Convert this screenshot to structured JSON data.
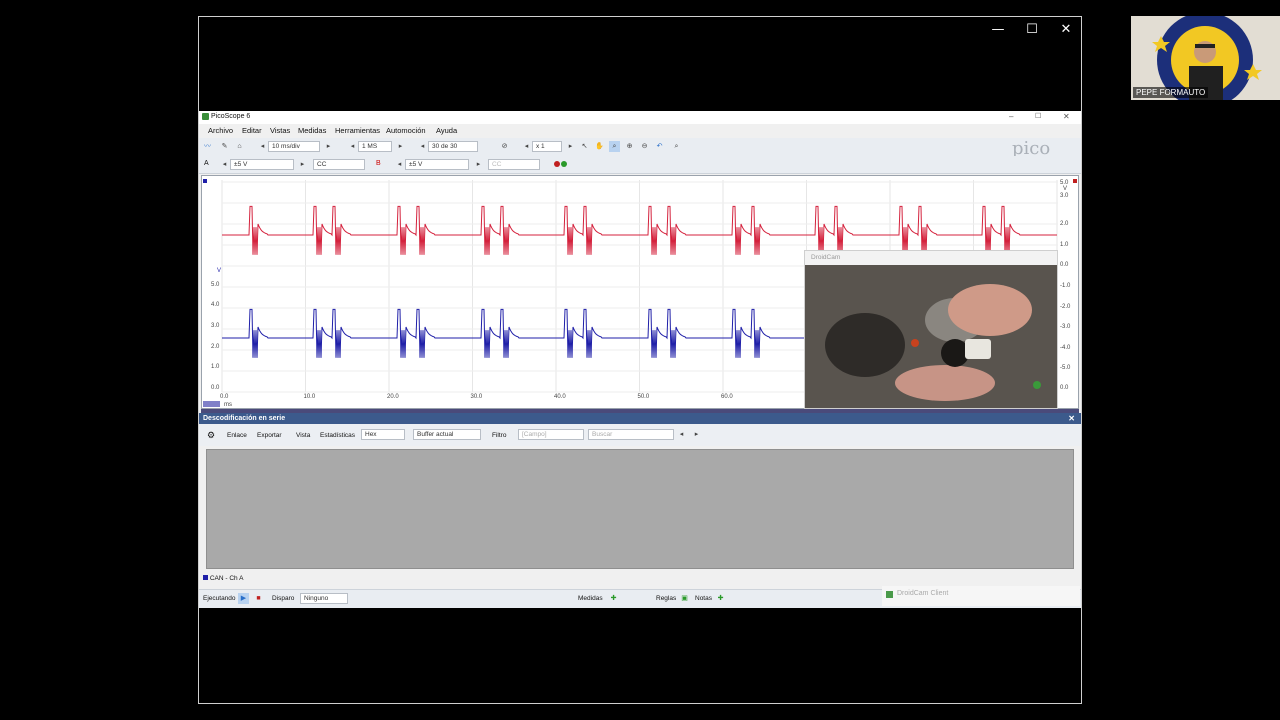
{
  "share": {
    "minimize": "—",
    "maximize": "☐",
    "close": "✕"
  },
  "webcam": {
    "name": "PEPE FORMAUTO"
  },
  "pico": {
    "title": "PicoScope 6",
    "menu": [
      "Archivo",
      "Editar",
      "Vistas",
      "Medidas",
      "Herramientas",
      "Automoción",
      "Ayuda"
    ],
    "toolbar1": {
      "timebase": "10 ms/div",
      "samples": "1 MS",
      "buffer": "30 de 30",
      "zoom": "x 1",
      "logo": "pico",
      "logo_sub": "Technology"
    },
    "toolbar2": {
      "ch_a_label": "A",
      "ch_a_range": "±5 V",
      "ch_a_coupling": "CC",
      "ch_b_label": "B",
      "ch_b_range": "±5 V",
      "ch_b_coupling": "CC"
    },
    "axes": {
      "left_unit": "V",
      "left_ticks": [
        "5.0",
        "4.0",
        "3.0",
        "2.0",
        "1.0",
        "0.0"
      ],
      "right_unit": "V",
      "right_ticks": [
        "5.0",
        "3.0",
        "2.0",
        "1.0",
        "0.0",
        "-1.0",
        "-2.0",
        "-3.0",
        "-4.0",
        "-5.0",
        "0.0"
      ],
      "x_ticks": [
        "0.0",
        "10.0",
        "20.0",
        "30.0",
        "40.0",
        "50.0",
        "60.0",
        "7"
      ],
      "x_unit": "ms"
    },
    "decode": {
      "header": "Descodificación en serie",
      "tools": [
        "Enlace",
        "Exportar",
        "Vista",
        "Estadísticas"
      ],
      "format": "Hex",
      "buffer": "Buffer actual",
      "filter": "Filtro",
      "field": "[Campo]",
      "search": "Buscar",
      "tab": "CAN - Ch A"
    },
    "status": {
      "run": "Ejecutando",
      "trigger": "Disparo",
      "trigger_mode": "Ninguno",
      "measures": "Medidas",
      "rulers": "Reglas",
      "notes": "Notas"
    },
    "colors": {
      "channel_a": "#d4213c",
      "channel_b": "#1f1fa8"
    }
  },
  "droidcam": {
    "title": "DroidCam",
    "client": "DroidCam Client"
  }
}
